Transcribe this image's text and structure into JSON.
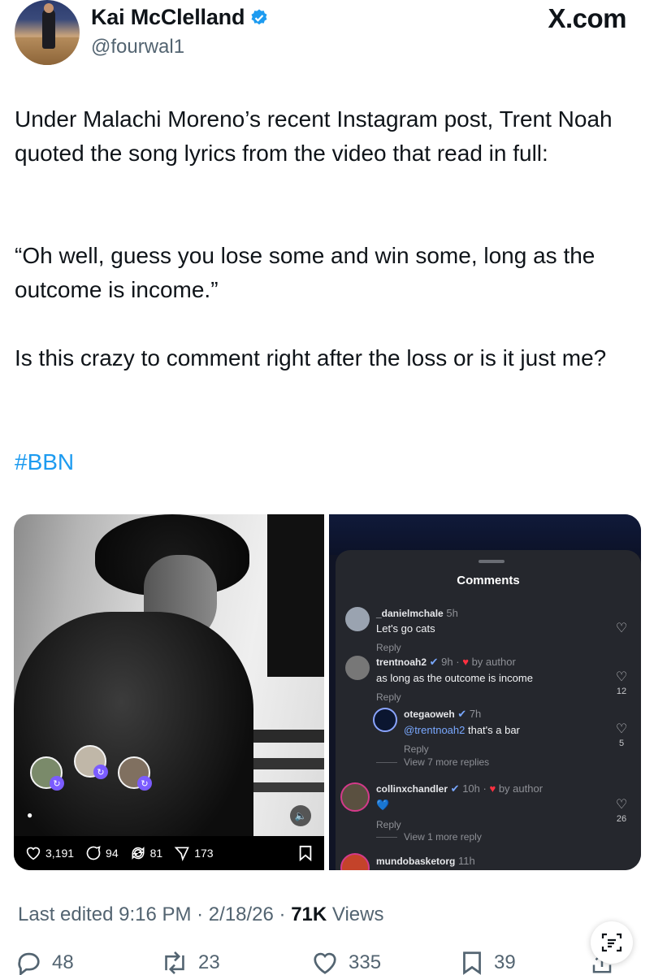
{
  "author": {
    "name": "Kai McClelland",
    "handle": "@fourwal1"
  },
  "site_logo": "X.com",
  "tweet": {
    "paragraph1": "Under Malachi Moreno’s recent Instagram post, Trent Noah quoted the song lyrics from the video that read in full:",
    "paragraph2": "“Oh well, guess you lose some and win some, long as the outcome is income.”",
    "paragraph3": "Is this crazy to comment right after the loss or is it just me?",
    "hashtag": "#BBN"
  },
  "left_media": {
    "likes": "3,191",
    "comments": "94",
    "reposts": "81",
    "shares": "173"
  },
  "right_media": {
    "title": "Comments",
    "comments": [
      {
        "user": "_danielmchale",
        "time": "5h",
        "text": "Let's go cats",
        "reply": "Reply"
      },
      {
        "user": "trentnoah2",
        "time": "9h",
        "by_author": "by author",
        "text": "as long as the outcome is income",
        "reply": "Reply",
        "likes": "12"
      },
      {
        "user": "otegaoweh",
        "time": "7h",
        "mention": "@trentnoah2",
        "text": " that's a bar",
        "reply": "Reply",
        "likes": "5"
      },
      {
        "user": "collinxchandler",
        "time": "10h",
        "by_author": "by author",
        "text": "💙",
        "reply": "Reply",
        "likes": "26"
      },
      {
        "user": "mundobasketorg",
        "time": "11h"
      }
    ],
    "view_more_1": "View 7 more replies",
    "view_more_2": "View 1 more reply"
  },
  "footer": {
    "edited": "Last edited 9:16 PM · 2/18/26 · ",
    "views_count": "71K",
    "views_label": " Views",
    "replies": "48",
    "reposts": "23",
    "likes": "335",
    "bookmarks": "39"
  },
  "colors": {
    "accent": "#1d9bf0",
    "text": "#0f1419",
    "muted": "#536471"
  },
  "icons": [
    "verified-badge-icon",
    "reply-icon",
    "repost-icon",
    "like-icon",
    "bookmark-icon",
    "share-icon",
    "grok-icon"
  ]
}
